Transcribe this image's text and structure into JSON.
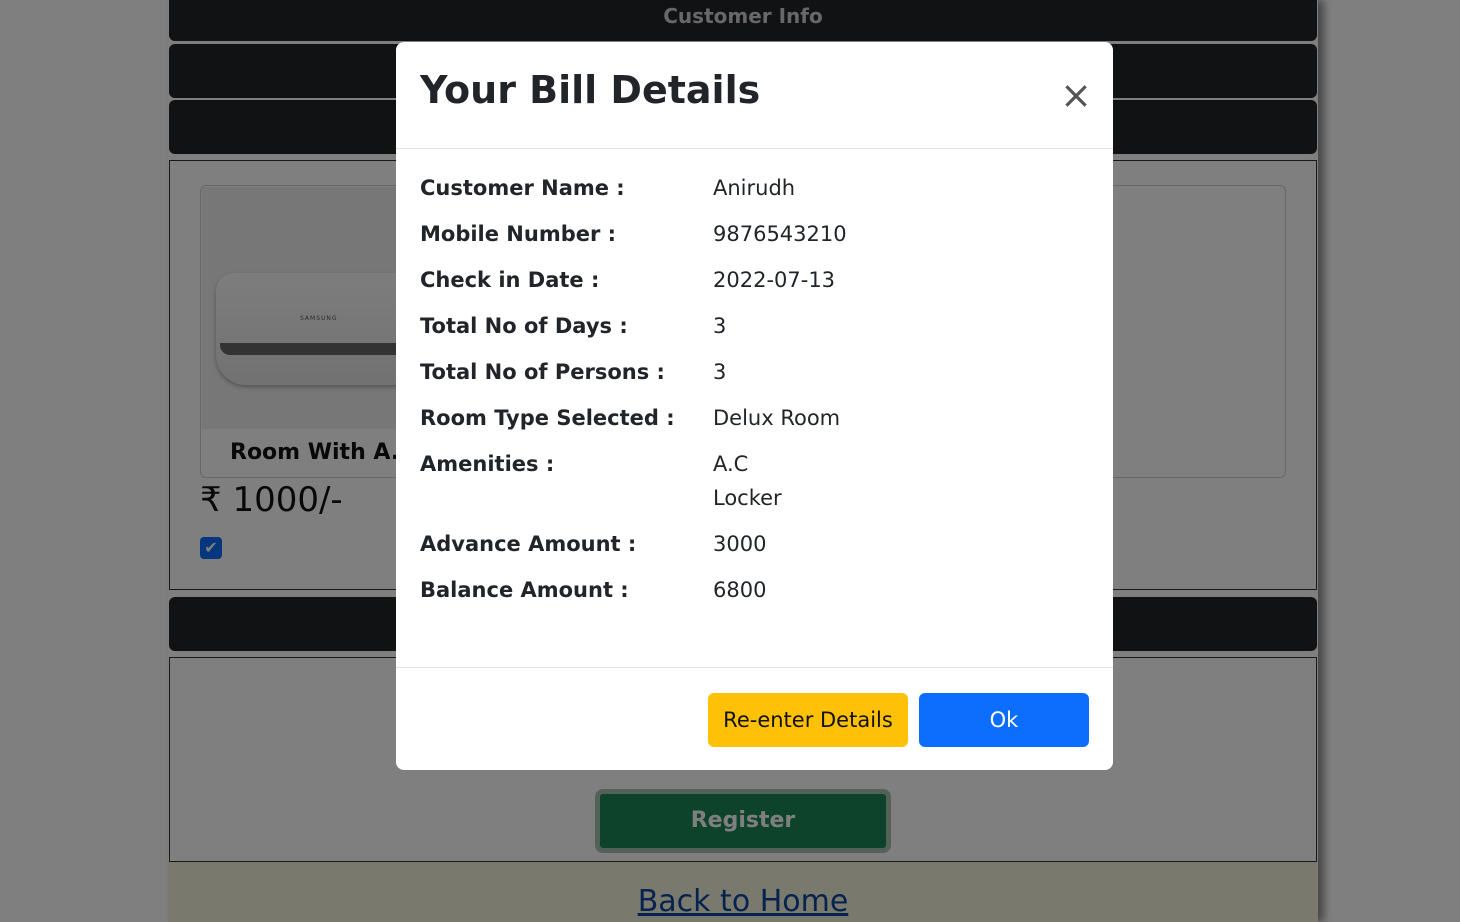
{
  "background": {
    "section_title": "Customer Info",
    "room": {
      "name": "Room With A.C",
      "price": "₹ 1000/-",
      "brand": "SAMSUNG",
      "checked": true
    },
    "register_label": "Register",
    "back_link": "Back to Home"
  },
  "modal": {
    "title": "Your Bill Details",
    "close_symbol": "×",
    "details": [
      {
        "label": "Customer Name :",
        "value": "Anirudh"
      },
      {
        "label": "Mobile Number :",
        "value": "9876543210"
      },
      {
        "label": "Check in Date :",
        "value": "2022-07-13"
      },
      {
        "label": "Total No of Days :",
        "value": "3"
      },
      {
        "label": "Total No of Persons :",
        "value": "3"
      },
      {
        "label": "Room Type Selected :",
        "value": "Delux Room"
      },
      {
        "label": "Amenities :",
        "values": [
          "A.C",
          "Locker"
        ]
      },
      {
        "label": "Advance Amount :",
        "value": "3000"
      },
      {
        "label": "Balance Amount :",
        "value": "6800"
      }
    ],
    "buttons": {
      "reenter": "Re-enter Details",
      "ok": "Ok"
    }
  },
  "colors": {
    "overlay": "#000000",
    "primary": "#0d6efd",
    "warning": "#ffc107",
    "success": "#198754",
    "dark_bar": "#212529"
  }
}
